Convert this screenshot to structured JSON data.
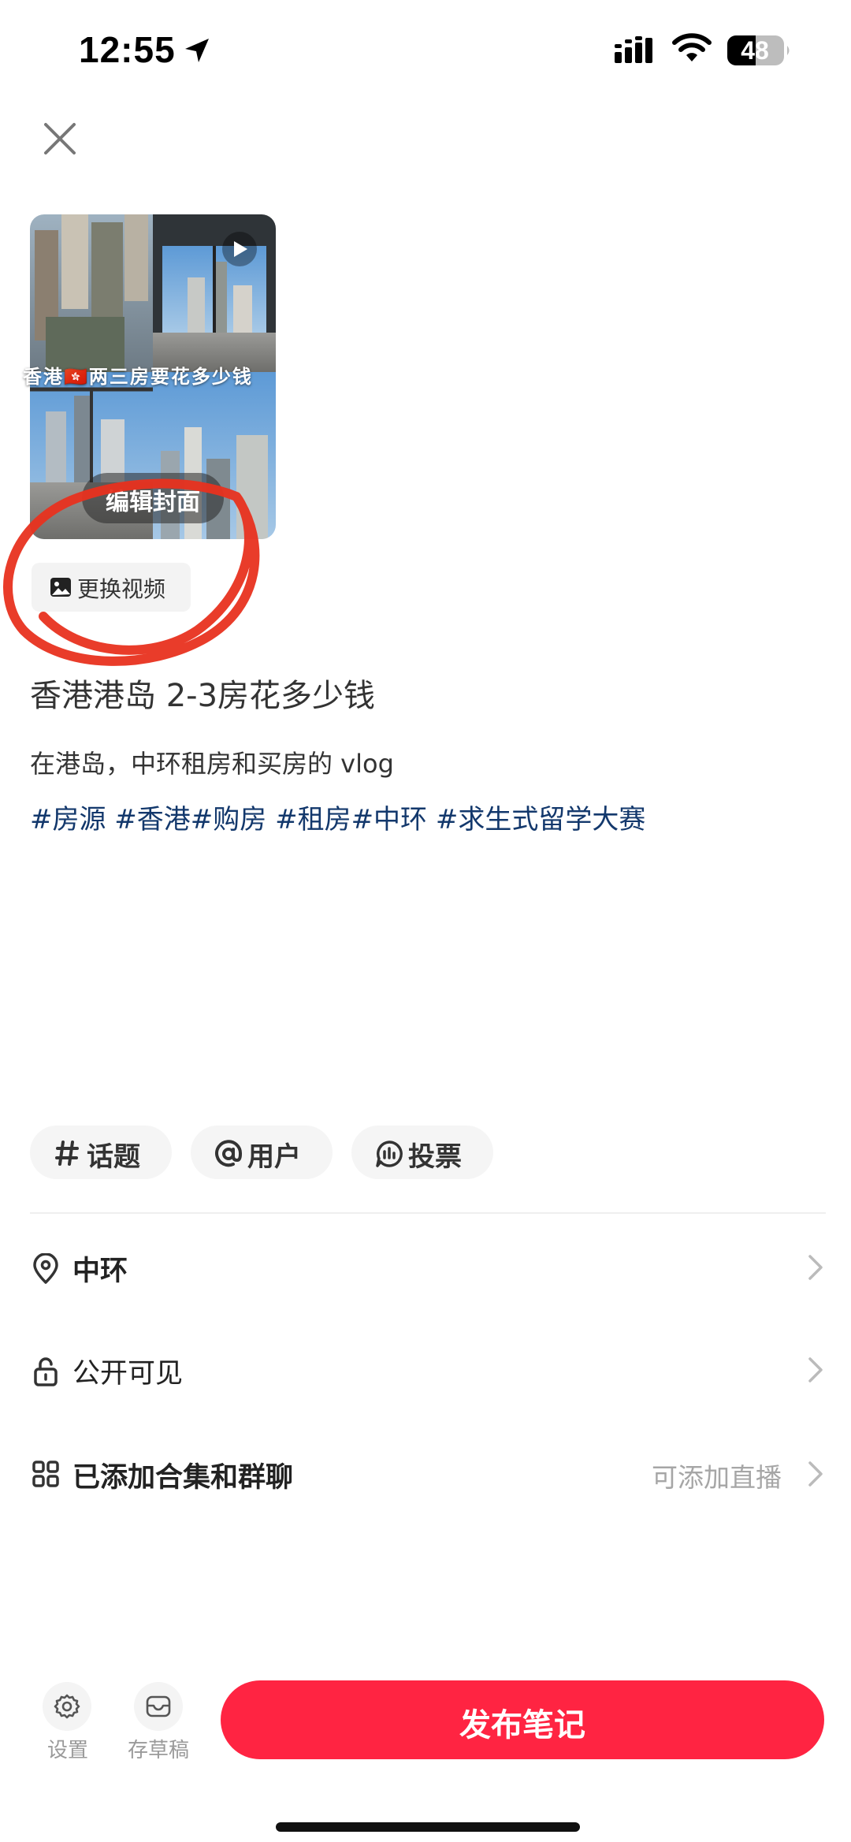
{
  "status_bar": {
    "time": "12:55",
    "battery": "48",
    "icons": [
      "location-arrow-icon",
      "cellular-signal-icon",
      "wifi-icon",
      "battery-icon"
    ]
  },
  "header": {
    "close_icon": "close-icon"
  },
  "cover": {
    "caption": "香港🇭🇰两三房要花多少钱",
    "edit_label": "编辑封面",
    "play_icon": "play-icon"
  },
  "replace_video": {
    "label": "更换视频",
    "icon": "image-icon"
  },
  "note": {
    "title": "香港港岛 2-3房花多少钱",
    "description": "在港岛，中环租房和买房的 vlog",
    "tags": "#房源 #香港#购房 #租房#中环 #求生式留学大赛"
  },
  "chips": [
    {
      "label": "话题",
      "icon": "hashtag-icon"
    },
    {
      "label": "用户",
      "icon": "at-icon"
    },
    {
      "label": "投票",
      "icon": "vote-icon"
    }
  ],
  "rows": {
    "location": {
      "label": "中环",
      "icon": "location-pin-icon"
    },
    "visibility": {
      "label": "公开可见",
      "icon": "lock-icon"
    },
    "collection": {
      "label": "已添加合集和群聊",
      "hint": "可添加直播",
      "icon": "grid-icon"
    }
  },
  "bottom_bar": {
    "settings_label": "设置",
    "draft_label": "存草稿",
    "publish_label": "发布笔记"
  },
  "colors": {
    "accent": "#ff2442",
    "tag_color": "#13386c",
    "annotation_red": "#e8321f"
  }
}
